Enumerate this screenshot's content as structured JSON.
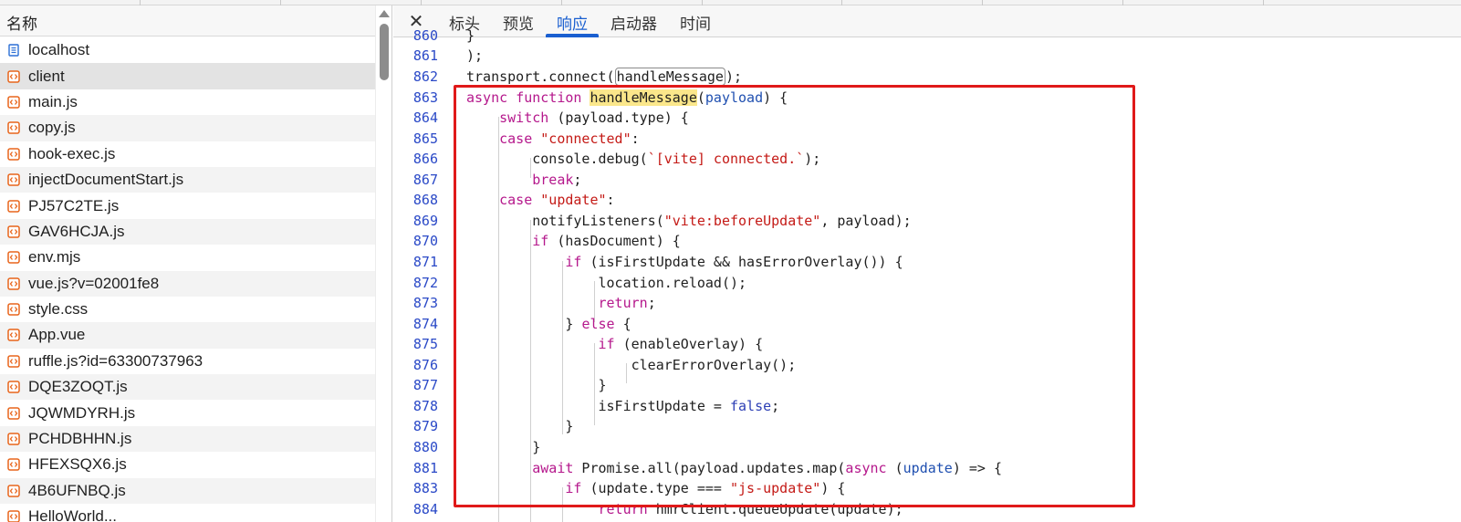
{
  "list": {
    "header": "名称",
    "items": [
      {
        "name": "localhost",
        "type": "doc"
      },
      {
        "name": "client",
        "type": "script"
      },
      {
        "name": "main.js",
        "type": "script"
      },
      {
        "name": "copy.js",
        "type": "script"
      },
      {
        "name": "hook-exec.js",
        "type": "script"
      },
      {
        "name": "injectDocumentStart.js",
        "type": "script"
      },
      {
        "name": "PJ57C2TE.js",
        "type": "script"
      },
      {
        "name": "GAV6HCJA.js",
        "type": "script"
      },
      {
        "name": "env.mjs",
        "type": "script"
      },
      {
        "name": "vue.js?v=02001fe8",
        "type": "script"
      },
      {
        "name": "style.css",
        "type": "script"
      },
      {
        "name": "App.vue",
        "type": "script"
      },
      {
        "name": "ruffle.js?id=63300737963",
        "type": "script"
      },
      {
        "name": "DQE3ZOQT.js",
        "type": "script"
      },
      {
        "name": "JQWMDYRH.js",
        "type": "script"
      },
      {
        "name": "PCHDBHHN.js",
        "type": "script"
      },
      {
        "name": "HFEXSQX6.js",
        "type": "script"
      },
      {
        "name": "4B6UFNBQ.js",
        "type": "script"
      },
      {
        "name": "HelloWorld...",
        "type": "script"
      }
    ],
    "selected_index": 1
  },
  "tabs": {
    "close_label": "✕",
    "items": [
      "标头",
      "预览",
      "响应",
      "启动器",
      "时间"
    ],
    "active_index": 2
  },
  "code": {
    "line_numbers": [
      "860",
      "861",
      "862",
      "863",
      "864",
      "865",
      "866",
      "867",
      "868",
      "869",
      "870",
      "871",
      "872",
      "873",
      "874",
      "875",
      "876",
      "877",
      "878",
      "879",
      "880",
      "881",
      "883",
      "884"
    ]
  },
  "colors": {
    "accent": "#1a5fd0",
    "highlight_frame": "#e01919",
    "keyword": "#b5188c",
    "string": "#c41a16",
    "line_number": "#2a49c7"
  },
  "icons": {
    "doc": "document-icon",
    "script": "script-file-icon",
    "close": "close-icon"
  }
}
